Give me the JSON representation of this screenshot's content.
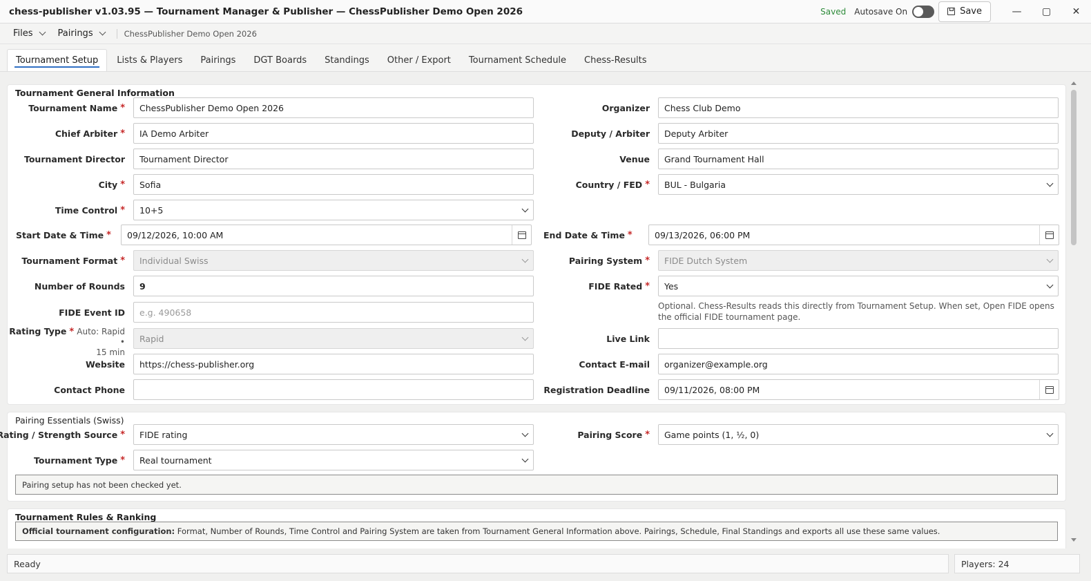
{
  "window": {
    "title": "chess-publisher v1.03.95 — Tournament Manager & Publisher — ChessPublisher Demo Open 2026",
    "saved_label": "Saved",
    "autosave_label": "Autosave On",
    "save_label": "Save",
    "minimize": "—",
    "maximize": "▢",
    "close": "✕"
  },
  "menubar": {
    "files_label": "Files",
    "pairings_label": "Pairings",
    "breadcrumb": "ChessPublisher Demo Open 2026"
  },
  "tabs": [
    {
      "label": "Tournament Setup",
      "active": true
    },
    {
      "label": "Lists & Players"
    },
    {
      "label": "Pairings"
    },
    {
      "label": "DGT Boards"
    },
    {
      "label": "Standings"
    },
    {
      "label": "Other / Export"
    },
    {
      "label": "Tournament Schedule"
    },
    {
      "label": "Chess-Results"
    }
  ],
  "general": {
    "title": "Tournament General Information",
    "tournament_name": {
      "label": "Tournament Name",
      "value": "ChessPublisher Demo Open 2026"
    },
    "organizer": {
      "label": "Organizer",
      "value": "Chess Club Demo"
    },
    "chief_arbiter": {
      "label": "Chief Arbiter",
      "value": "IA Demo Arbiter"
    },
    "deputy_arbiter": {
      "label": "Deputy / Arbiter",
      "value": "Deputy Arbiter"
    },
    "tournament_director": {
      "label": "Tournament Director",
      "value": "Tournament Director"
    },
    "venue": {
      "label": "Venue",
      "value": "Grand Tournament Hall"
    },
    "city": {
      "label": "City",
      "value": "Sofia"
    },
    "country": {
      "label": "Country / FED",
      "value": "BUL - Bulgaria"
    },
    "time_control": {
      "label": "Time Control",
      "value": "10+5"
    },
    "start_date": {
      "label": "Start Date & Time",
      "value": "09/12/2026, 10:00 AM"
    },
    "end_date": {
      "label": "End Date & Time",
      "value": "09/13/2026, 06:00 PM"
    },
    "tournament_format": {
      "label": "Tournament Format",
      "value": "Individual Swiss"
    },
    "pairing_system": {
      "label": "Pairing System",
      "value": "FIDE Dutch System"
    },
    "rounds": {
      "label": "Number of Rounds",
      "value": "9"
    },
    "fide_rated": {
      "label": "FIDE Rated",
      "value": "Yes"
    },
    "fide_event_id": {
      "label": "FIDE Event ID",
      "placeholder": "e.g. 490658"
    },
    "fide_help": "Optional. Chess-Results reads this directly from Tournament Setup. When set, Open FIDE opens the official FIDE tournament page.",
    "rating_type": {
      "label": "Rating Type",
      "hint": "Auto: Rapid •",
      "hint2": "15 min",
      "value": "Rapid"
    },
    "live_link": {
      "label": "Live Link",
      "value": ""
    },
    "website": {
      "label": "Website",
      "value": "https://chess-publisher.org"
    },
    "contact_email": {
      "label": "Contact E-mail",
      "value": "organizer@example.org"
    },
    "contact_phone": {
      "label": "Contact Phone",
      "value": ""
    },
    "registration_deadline": {
      "label": "Registration Deadline",
      "value": "09/11/2026, 08:00 PM"
    }
  },
  "pairing": {
    "title": "Pairing Essentials (Swiss)",
    "rating_source": {
      "label": "Rating / Strength Source",
      "value": "FIDE rating"
    },
    "pairing_score": {
      "label": "Pairing Score",
      "value": "Game points (1, ½, 0)"
    },
    "tournament_type": {
      "label": "Tournament Type",
      "value": "Real tournament"
    },
    "status": "Pairing setup has not been checked yet."
  },
  "rules": {
    "title": "Tournament Rules & Ranking",
    "note_bold": "Official tournament configuration:",
    "note_text": " Format, Number of Rounds, Time Control and Pairing System are taken from Tournament General Information above. Pairings, Schedule, Final Standings and exports all use these same values."
  },
  "status": {
    "left": "Ready",
    "right": "Players: 24"
  }
}
